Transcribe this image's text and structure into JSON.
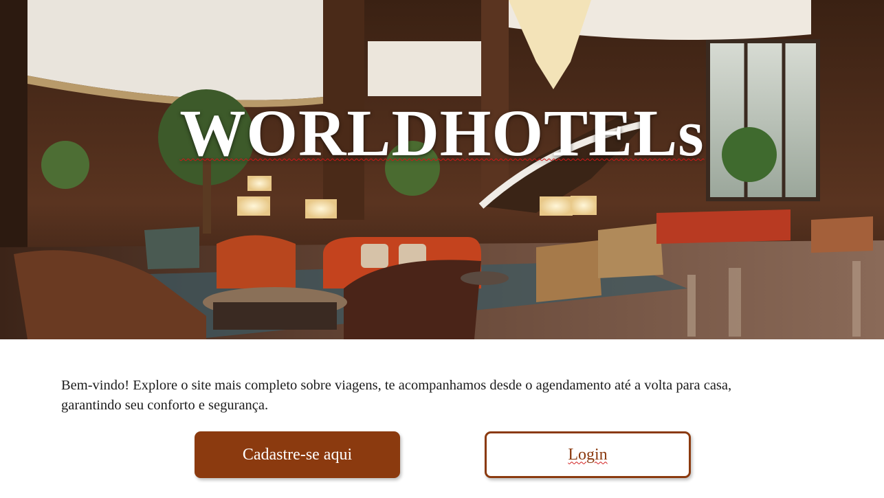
{
  "hero": {
    "title": "WORLDHOTELs",
    "image_alt": "hotel-lobby-photo"
  },
  "intro": {
    "text": "Bem-vindo! Explore o site mais completo sobre viagens, te acompanhamos desde o agendamento até a volta para casa, garantindo seu conforto e segurança."
  },
  "actions": {
    "signup_label": "Cadastre-se aqui",
    "login_label": "Login"
  },
  "colors": {
    "accent": "#8b3a0f",
    "text": "#1b1b1b",
    "background": "#ffffff"
  }
}
